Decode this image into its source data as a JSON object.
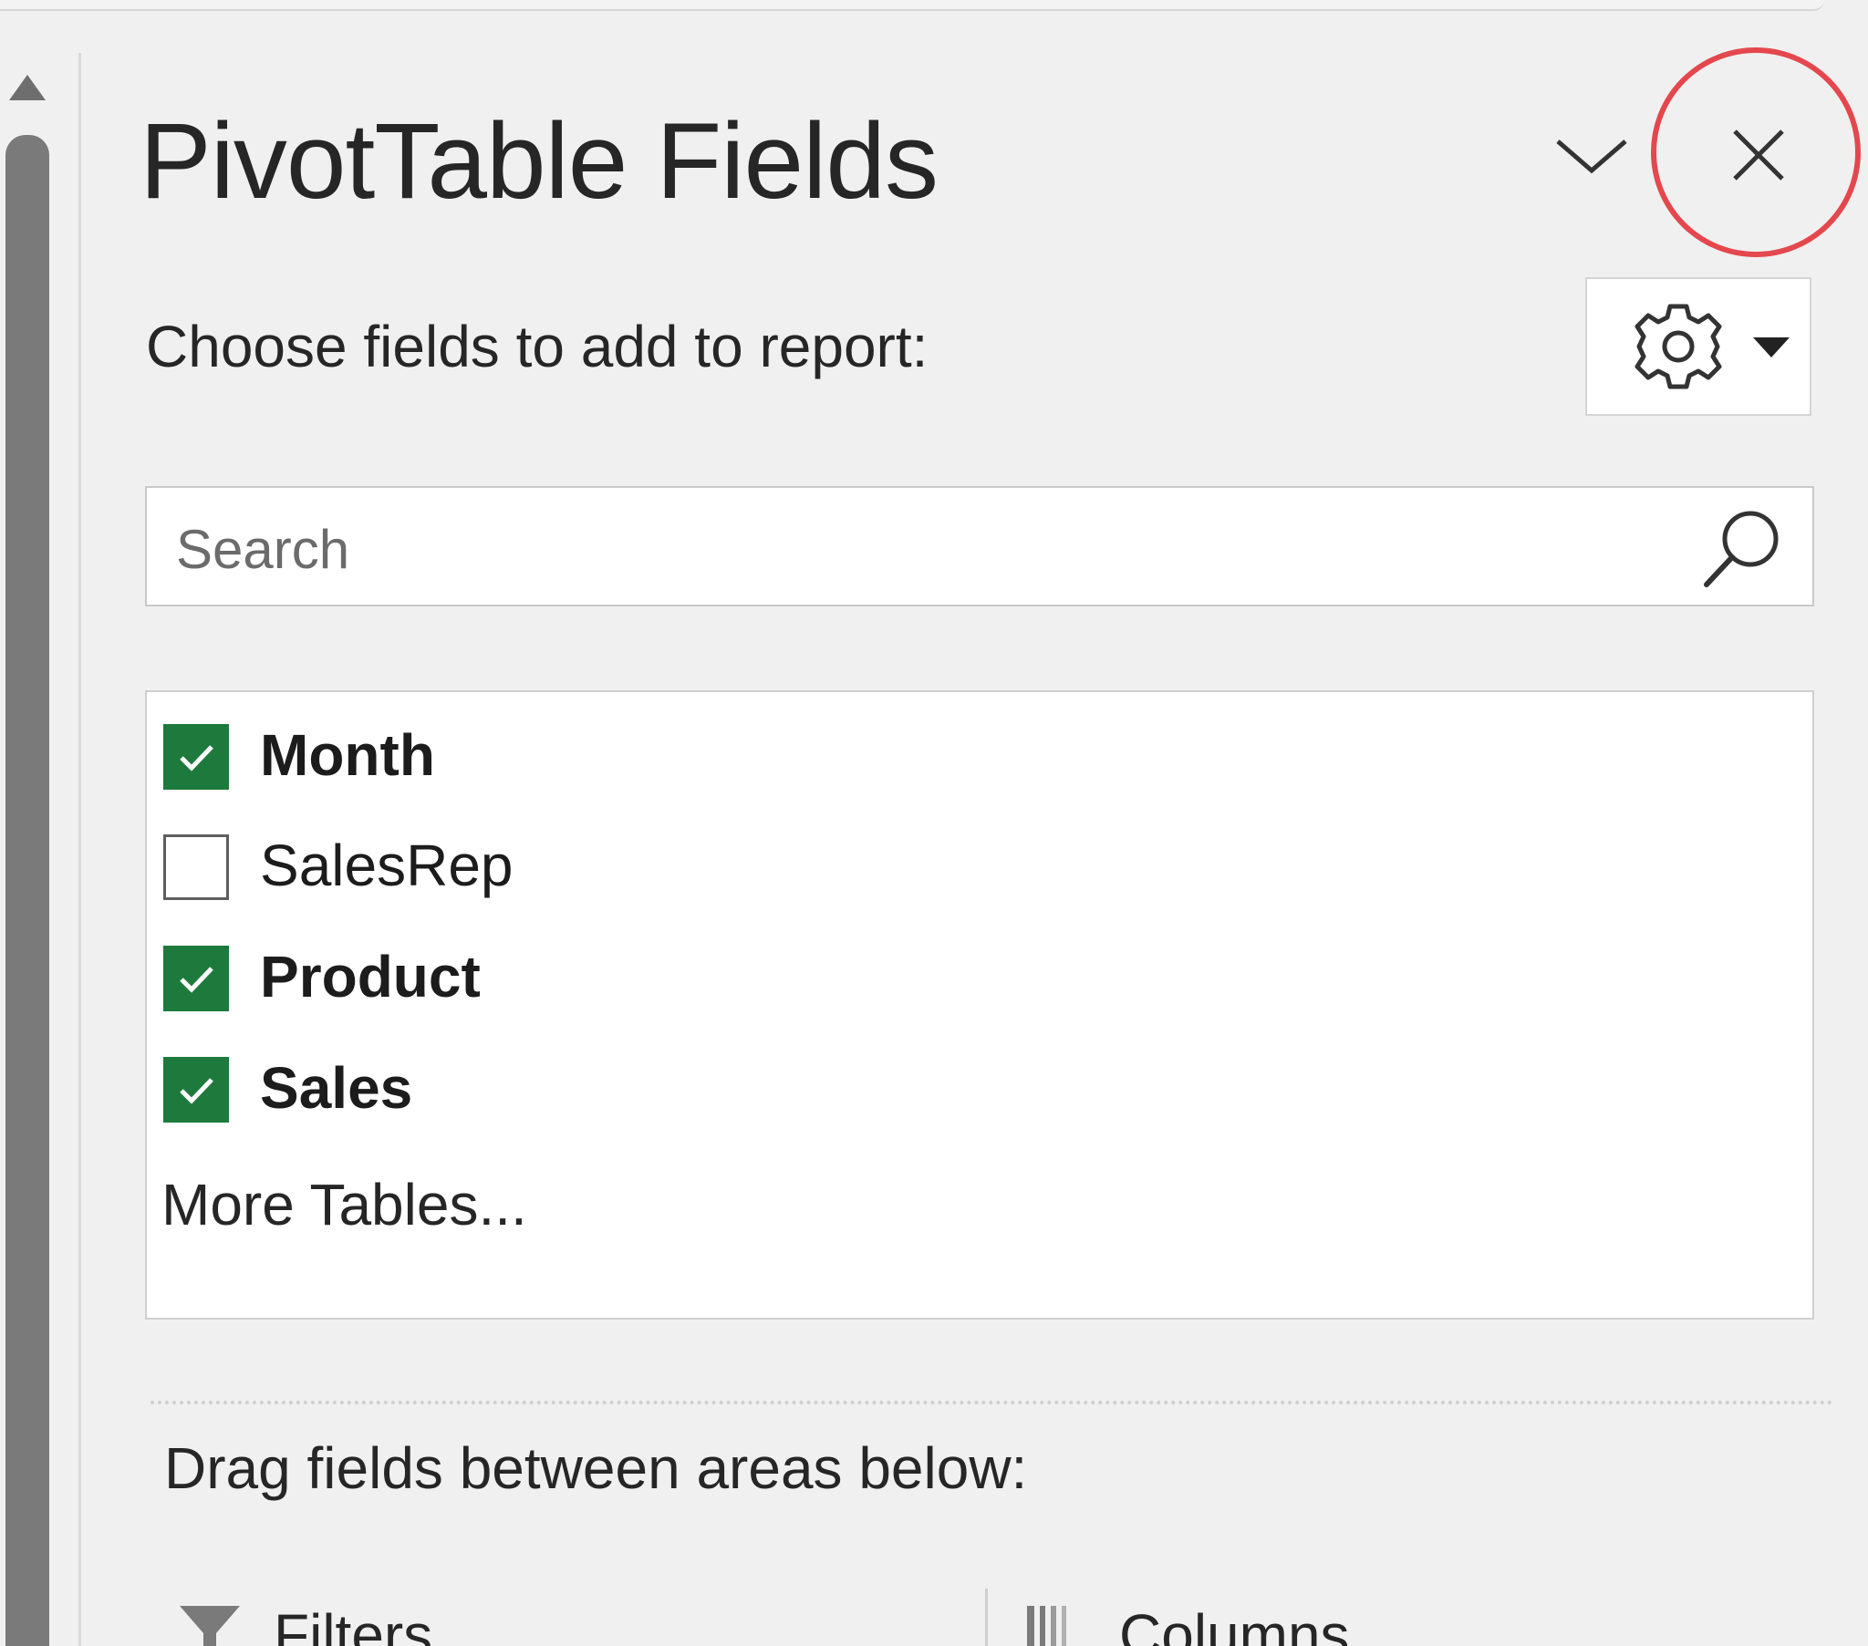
{
  "pane": {
    "title": "PivotTable Fields",
    "subtitle": "Choose fields to add to report:",
    "collapse_icon": "chevron-down-icon",
    "close_icon": "close-icon",
    "tools_icon": "gear-icon",
    "tools_dropdown_icon": "caret-down-icon"
  },
  "search": {
    "placeholder": "Search",
    "value": "",
    "icon": "search-icon"
  },
  "fields": [
    {
      "label": "Month",
      "checked": true
    },
    {
      "label": "SalesRep",
      "checked": false
    },
    {
      "label": "Product",
      "checked": true
    },
    {
      "label": "Sales",
      "checked": true
    }
  ],
  "more_tables": "More Tables...",
  "areas": {
    "instruction": "Drag fields between areas below:",
    "filters_label": "Filters",
    "columns_label": "Columns"
  },
  "colors": {
    "checkbox_checked": "#1e7a3c",
    "highlight_ring": "#e4474d",
    "pane_background": "#f0f0f0"
  }
}
